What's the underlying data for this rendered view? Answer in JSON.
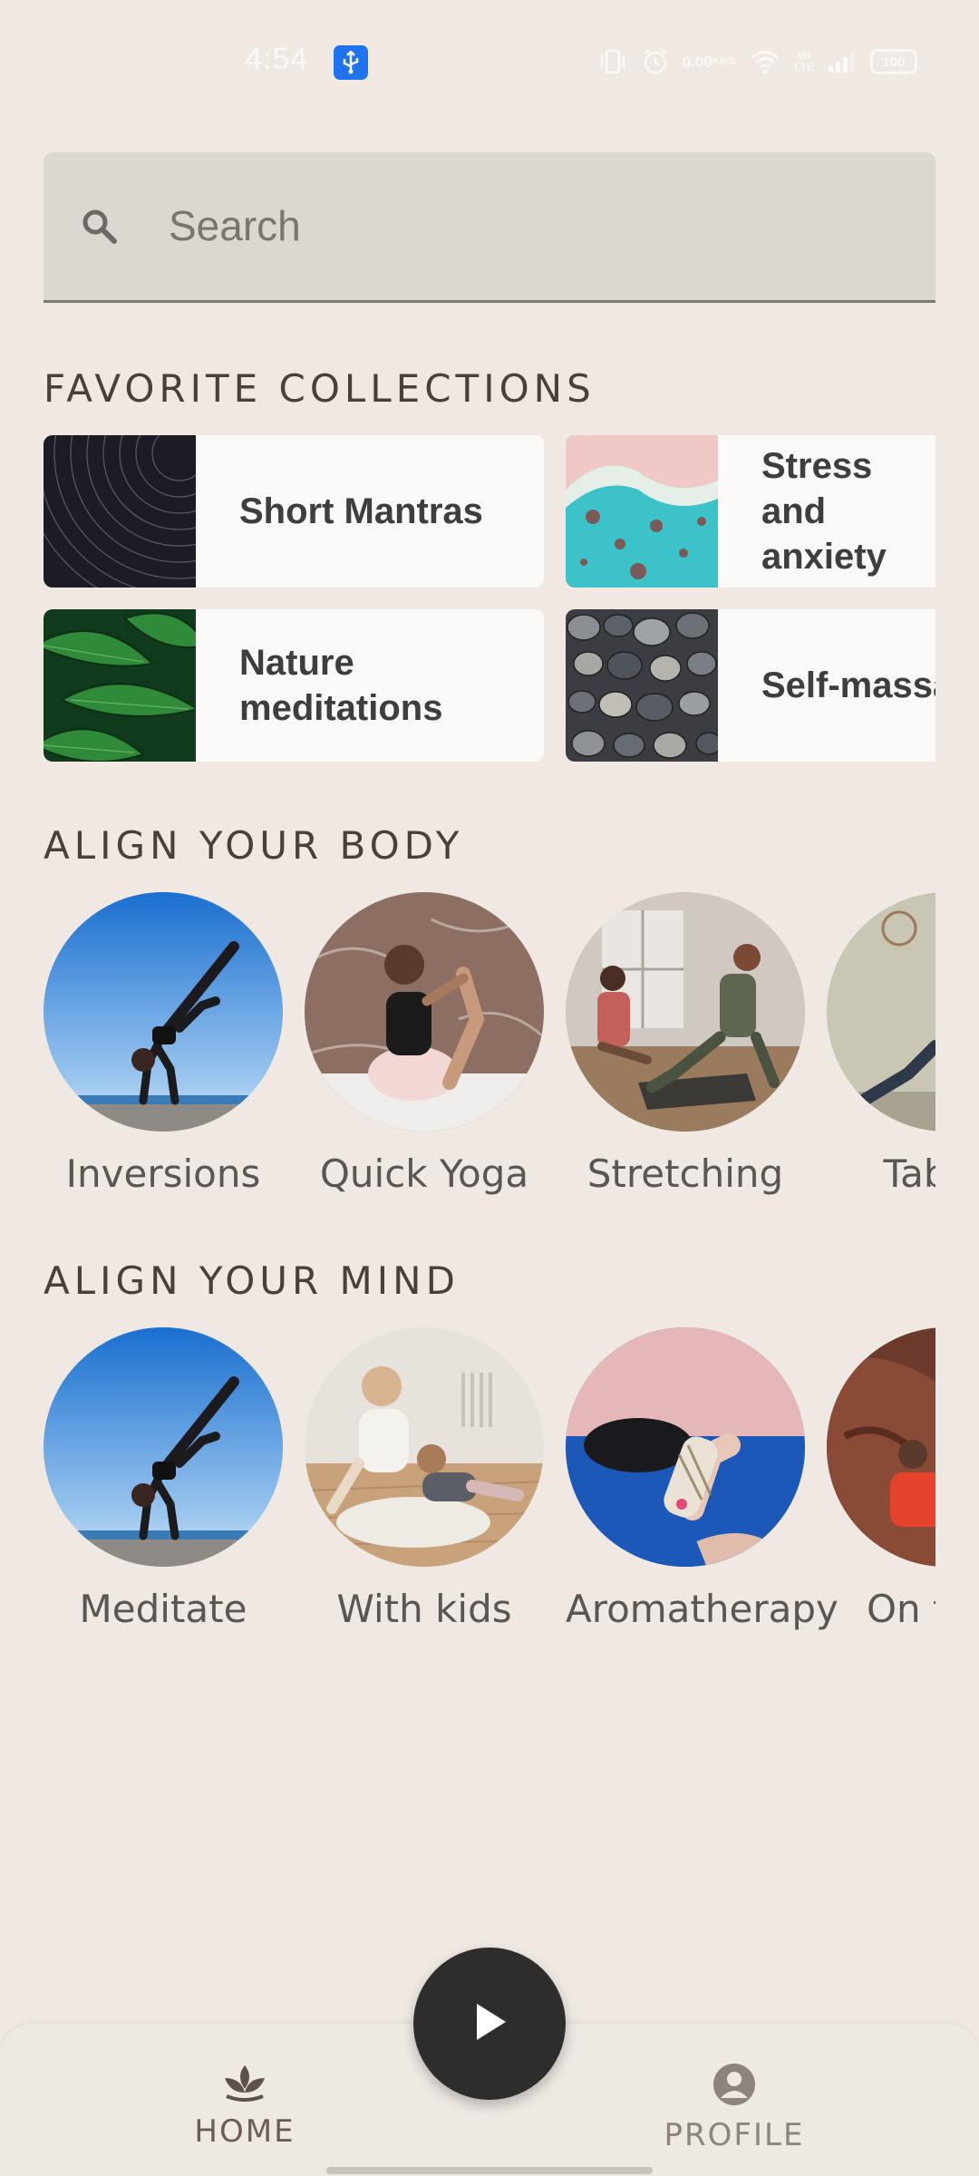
{
  "status_bar": {
    "time": "4:54",
    "net_speed_value": "0.00",
    "net_speed_unit": "KB/S",
    "volte": "Vo LTE",
    "battery": "100"
  },
  "search": {
    "placeholder": "Search"
  },
  "favorites": {
    "title": "FAVORITE COLLECTIONS",
    "items": [
      {
        "label": "Short Mantras"
      },
      {
        "label": "Stress and anxiety"
      },
      {
        "label": "Nature meditations"
      },
      {
        "label": "Self-massage"
      }
    ]
  },
  "body": {
    "title": "ALIGN YOUR BODY",
    "items": [
      {
        "label": "Inversions"
      },
      {
        "label": "Quick Yoga"
      },
      {
        "label": "Stretching"
      },
      {
        "label": "Tabata"
      }
    ]
  },
  "mind": {
    "title": "ALIGN YOUR MIND",
    "items": [
      {
        "label": "Meditate"
      },
      {
        "label": "With kids"
      },
      {
        "label": "Aromatherapy"
      },
      {
        "label": "On the go"
      }
    ]
  },
  "nav": {
    "home_label": "HOME",
    "profile_label": "PROFILE"
  },
  "colors": {
    "background": "#f0e9e3",
    "card": "#fbf9f7",
    "fab": "#2d2d2d",
    "usb_badge": "#1f73ee"
  }
}
